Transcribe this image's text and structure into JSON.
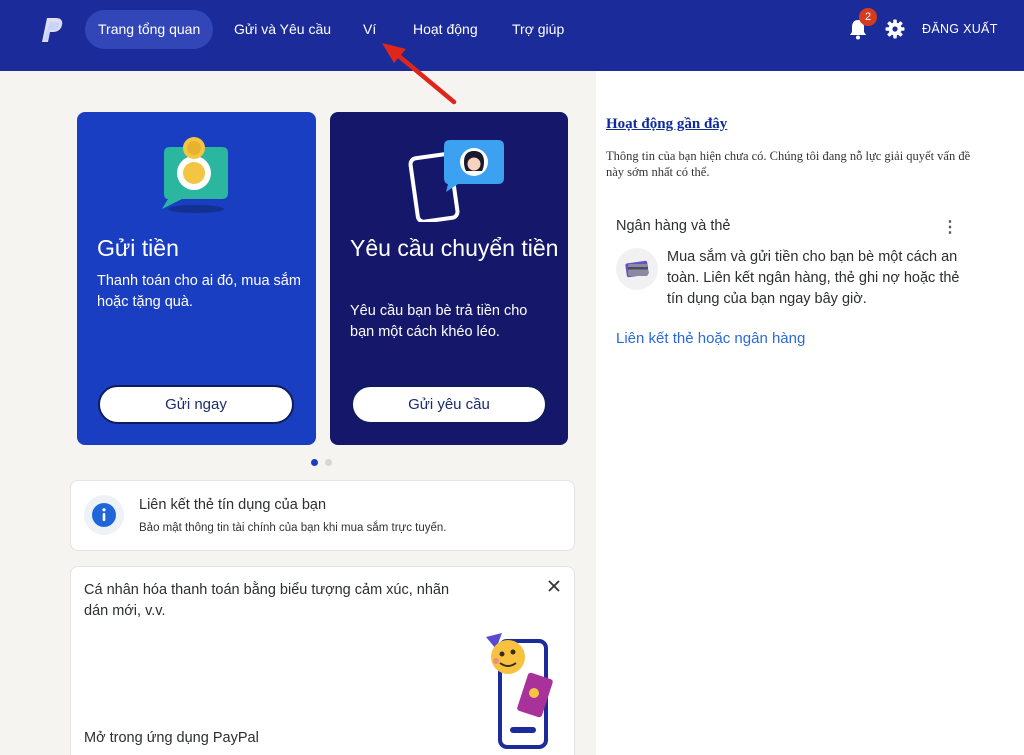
{
  "nav": {
    "logo": "paypal-logo-icon",
    "items": [
      {
        "label": "Trang tổng quan",
        "active": true
      },
      {
        "label": "Gửi và Yêu cầu",
        "active": false
      },
      {
        "label": "Ví",
        "active": false
      },
      {
        "label": "Hoạt động",
        "active": false
      },
      {
        "label": "Trợ giúp",
        "active": false
      }
    ],
    "notification_count": "2",
    "logout_label": "ĐĂNG XUẤT"
  },
  "colors": {
    "nav_bg": "#1b2c9a",
    "send_card": "#1a3ec2",
    "request_card": "#15186a",
    "link": "#2a6ad9",
    "badge": "#d43c1f",
    "annotation_arrow": "#e0261b"
  },
  "cards": [
    {
      "title": "Gửi tiền",
      "description": "Thanh toán cho ai đó, mua sắm hoặc tặng quà.",
      "button": "Gửi ngay",
      "icon": "chat-coin-icon"
    },
    {
      "title": "Yêu cầu chuyển tiền",
      "description": "Yêu cầu bạn bè trả tiền cho bạn một cách khéo léo.",
      "button": "Gửi yêu cầu",
      "icon": "phone-avatar-icon"
    }
  ],
  "carousel": {
    "total": 2,
    "active_index": 0
  },
  "info_box": {
    "title": "Liên kết thẻ tín dụng của bạn",
    "subtitle": "Bảo mật thông tin tài chính của bạn khi mua sắm trực tuyến."
  },
  "promo_box": {
    "text": "Cá nhân hóa thanh toán bằng biểu tượng cảm xúc, nhãn dán mới, v.v.",
    "link": "Mở trong ứng dụng PayPal"
  },
  "right_panel": {
    "activity_title": "Hoạt động gần đây",
    "activity_text": "Thông tin của bạn hiện chưa có. Chúng tôi đang nỗ lực giải quyết vấn đề này sớm nhất có thể.",
    "bank_title": "Ngân hàng và thẻ",
    "bank_text": "Mua sắm và gửi tiền cho bạn bè một cách an toàn. Liên kết ngân hàng, thẻ ghi nợ hoặc thẻ tín dụng của bạn ngay bây giờ.",
    "bank_link": "Liên kết thẻ hoặc ngân hàng"
  }
}
